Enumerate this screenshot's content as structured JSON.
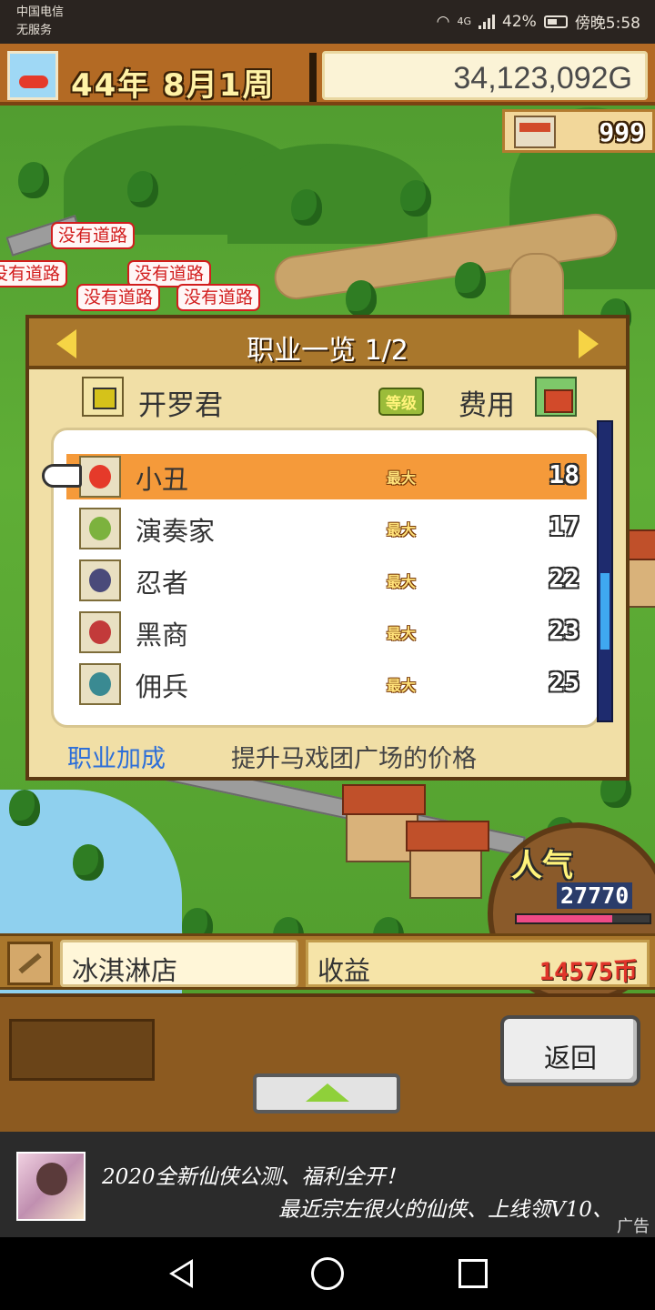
{
  "status_bar": {
    "carrier_line1": "中国电信",
    "carrier_line2": "无服务",
    "network": "4G",
    "battery": "42%",
    "time": "傍晚5:58"
  },
  "hud": {
    "date": "44年 8月1周",
    "money": "34,123,092G",
    "population": "999"
  },
  "map_labels": [
    "没有道路",
    "没有道路",
    "没有道路",
    "没有道路",
    "没有道路"
  ],
  "dialog": {
    "title": "职业一览 1/2",
    "kairo_name": "开罗君",
    "level_badge": "等级",
    "cost_label": "费用",
    "jobs": [
      {
        "name": "小丑",
        "level": "最大",
        "cost": "18",
        "avatar": "clown-avatar-icon",
        "selected": true
      },
      {
        "name": "演奏家",
        "level": "最大",
        "cost": "17",
        "avatar": "musician-avatar-icon",
        "selected": false
      },
      {
        "name": "忍者",
        "level": "最大",
        "cost": "22",
        "avatar": "ninja-avatar-icon",
        "selected": false
      },
      {
        "name": "黑商",
        "level": "最大",
        "cost": "23",
        "avatar": "merchant-avatar-icon",
        "selected": false
      },
      {
        "name": "佣兵",
        "level": "最大",
        "cost": "25",
        "avatar": "mercenary-avatar-icon",
        "selected": false
      }
    ],
    "bonus_label": "职业加成",
    "bonus_text": "提升马戏团广场的价格"
  },
  "popularity": {
    "title": "人气",
    "value": "27770",
    "bar_fraction": 0.72
  },
  "building": {
    "name": "冰淇淋店",
    "revenue_label": "收益",
    "revenue_value": "14575币"
  },
  "controls": {
    "back_label": "返回"
  },
  "ad": {
    "line1": "2020全新仙侠公测、福利全开！",
    "line2": "最近宗左很火的仙侠、上线领V10、",
    "badge": "广告"
  },
  "colors": {
    "selected_row": "#f59a3a",
    "accent_blue": "#2e6fd8",
    "revenue_red": "#e0342a"
  }
}
